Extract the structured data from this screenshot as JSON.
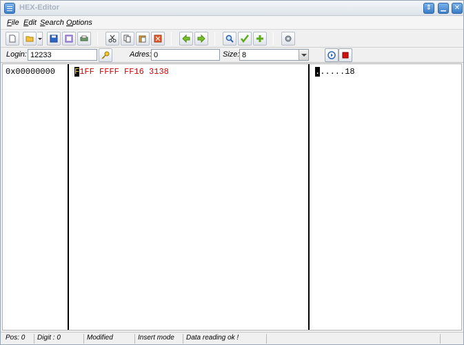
{
  "window": {
    "title": "HEX-Editor"
  },
  "menu": {
    "items": [
      {
        "underline": "F",
        "rest": "ile"
      },
      {
        "underline": "E",
        "rest": "dit"
      },
      {
        "underline": "S",
        "rest": "earch"
      },
      {
        "underline": "O",
        "rest": "ptions"
      }
    ]
  },
  "toolbar": {
    "icons": [
      "new-file",
      "open-folder",
      "save-disk",
      "print-preview",
      "print",
      "cut",
      "copy",
      "paste",
      "delete",
      "arrow-left",
      "arrow-right",
      "search-magnifier",
      "checkmark",
      "plus",
      "gear"
    ]
  },
  "fields": {
    "login_label": "Login:",
    "login_value": "12233",
    "adres_label": "Adres:",
    "adres_value": "0",
    "size_label": "Size:",
    "size_value": "8"
  },
  "editor": {
    "address": "0x00000000",
    "hex_cursor_char": "F",
    "hex_first_group_rest": "1FF",
    "hex_group_2": "FFFF",
    "hex_group_3": "FF16",
    "hex_group_4": "3138",
    "ascii_cursor_char": ".",
    "ascii_rest": ".....18"
  },
  "status": {
    "pos": "Pos: 0",
    "digit": "Digit : 0",
    "modified": "Modified",
    "mode": "Insert mode",
    "message": "Data reading ok !"
  },
  "colors": {
    "hex_text": "#d40000",
    "cursor_bg": "#000000",
    "cursor_fg": "#ffe14a",
    "title_text": "#a9b3bf"
  }
}
